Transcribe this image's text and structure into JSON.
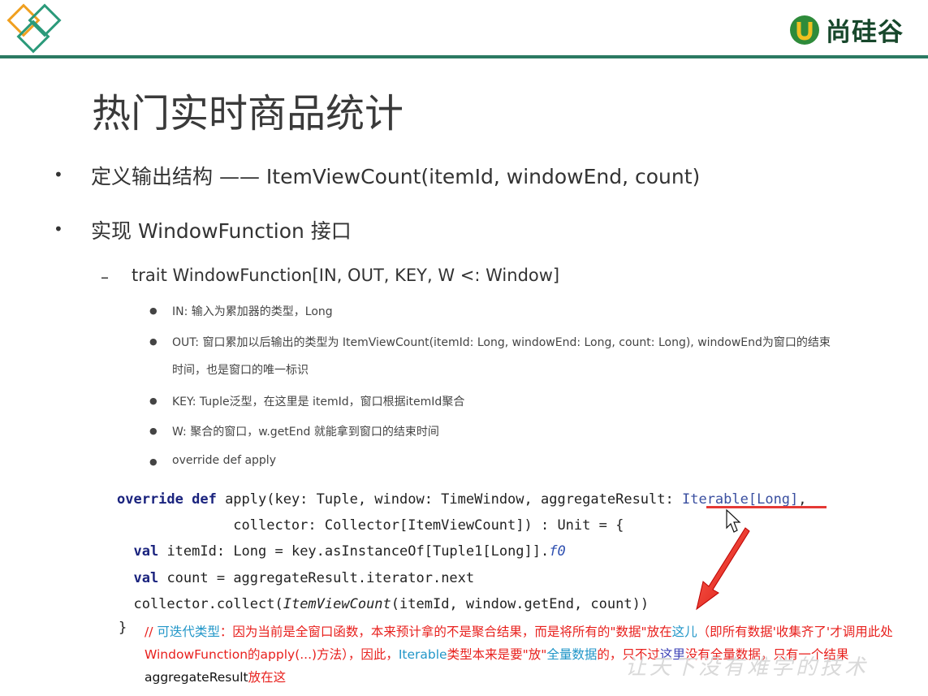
{
  "brand": {
    "name": "尚硅谷"
  },
  "title": "热门实时商品统计",
  "bullets": [
    {
      "text": "定义输出结构 —— ItemViewCount(itemId, windowEnd, count)"
    },
    {
      "text": "实现 WindowFunction 接口"
    }
  ],
  "sub_item": "trait WindowFunction[IN, OUT, KEY, W <: Window]",
  "details": [
    "IN: 输入为累加器的类型，Long",
    "OUT: 窗口累加以后输出的类型为 ItemViewCount(itemId:  Long, windowEnd: Long, count: Long), windowEnd为窗口的结束",
    "时间，也是窗口的唯一标识",
    "KEY: Tuple泛型，在这里是 itemId，窗口根据itemId聚合",
    "W: 聚合的窗口，w.getEnd 就能拿到窗口的结束时间",
    "override def apply"
  ],
  "code": {
    "l1_kw": "override def",
    "l1_a": " apply(key: Tuple, window: TimeWindow, aggregateResult: ",
    "l1_link": "Iterable[Long]",
    "l1_b": ",",
    "l2": "              collector: Collector[ItemViewCount]) : Unit = {",
    "l3_kw": "val",
    "l3_a": " itemId: Long = key.asInstanceOf[Tuple1[Long]].",
    "l3_it": "f0",
    "l4_kw": "val",
    "l4_a": " count = aggregateResult.iterator.next",
    "l5_a": "collector.collect(",
    "l5_it": "ItemViewCount",
    "l5_b": "(itemId, window.getEnd, count))",
    "close": "}"
  },
  "comment": {
    "p1": "// ",
    "p2": "可迭代类型",
    "p3": "：因为当前是全窗口函数，本来预计拿的不是聚合结果，而是将所有的\"数据\"放在",
    "p4": "这儿",
    "p5": "（即所有数据'收集齐了'才调用此处WindowFunction的apply(...)方法），因此，",
    "p6": "Iterable",
    "p7": "类型本来是要\"放\"",
    "p8": "全量数据",
    "p9": "的，只不过",
    "p10": "这里",
    "p11": "没有全量数据，只有一个结果",
    "p12": "aggregateResult",
    "p13": "放在这"
  },
  "watermark": "让天下没有难学的技术",
  "colors": {
    "accent": "#2b7a62",
    "logo_orange": "#f0a020",
    "comment_red": "#e8201d",
    "underline_red": "#e53935"
  }
}
